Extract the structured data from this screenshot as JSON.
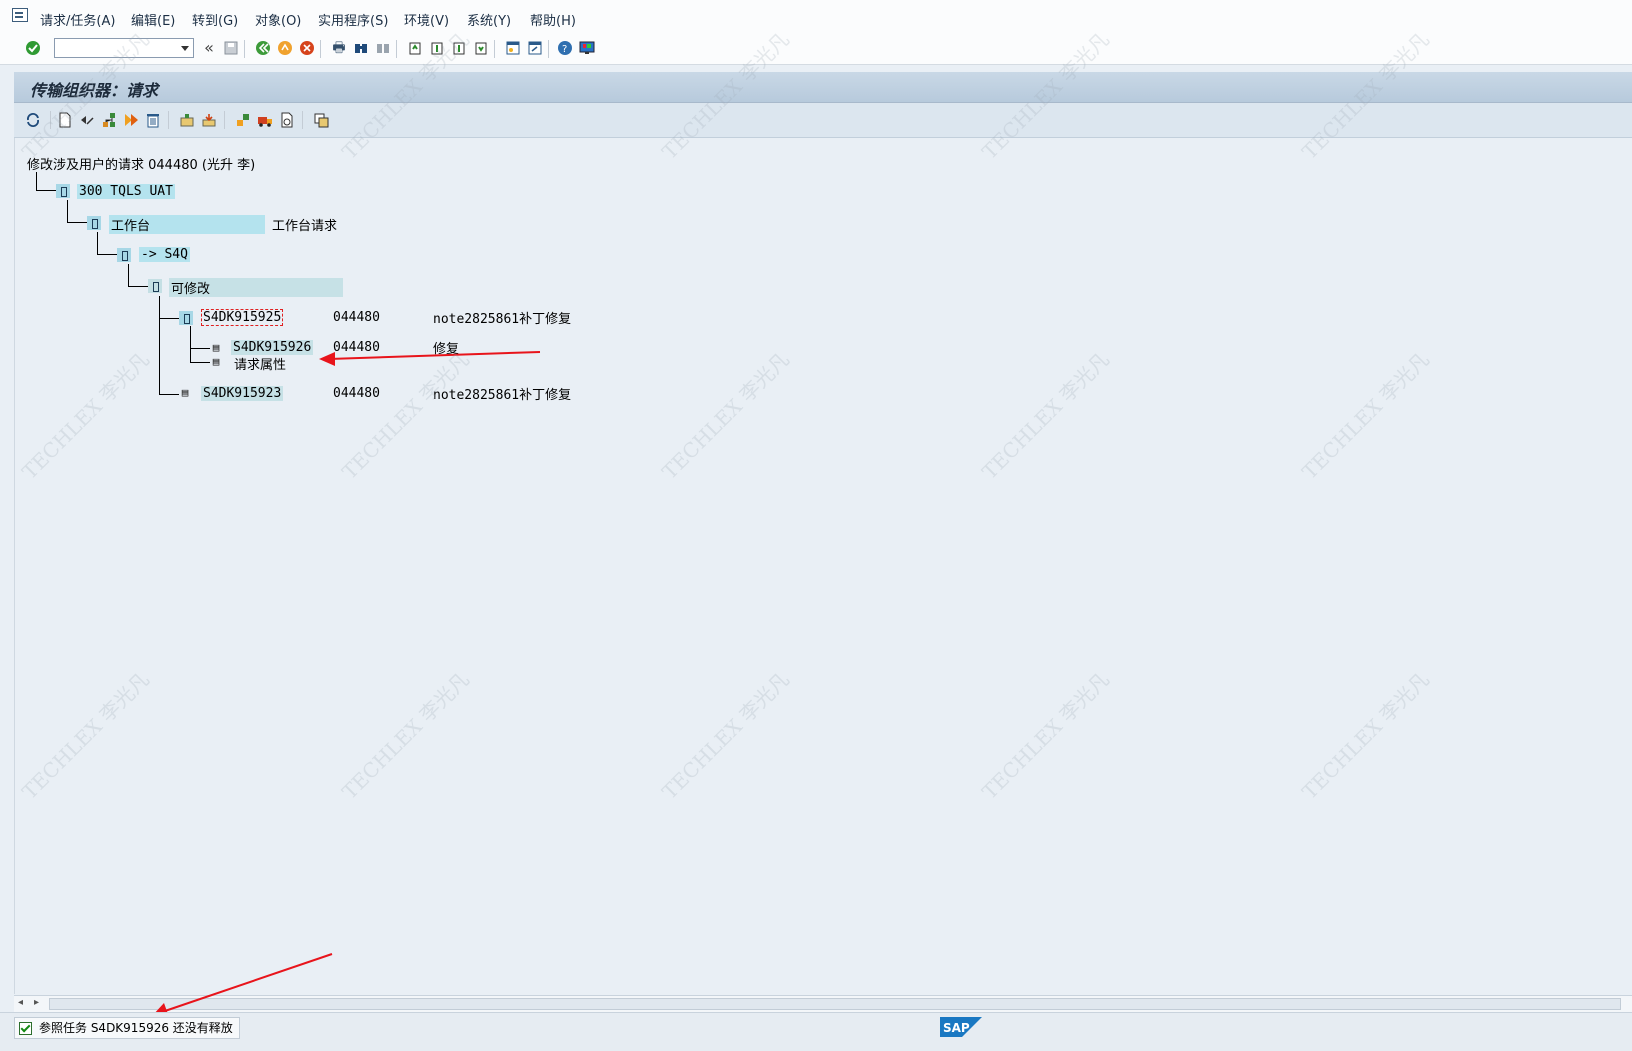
{
  "menu": {
    "items": [
      "请求/任务(A)",
      "编辑(E)",
      "转到(G)",
      "对象(O)",
      "实用程序(S)",
      "环境(V)",
      "系统(Y)",
      "帮助(H)"
    ]
  },
  "command_field": {
    "value": ""
  },
  "title": "传输组织器：请求",
  "tree": {
    "root": "修改涉及用户的请求 044480 (光升 李)",
    "client": "300 TQLS UAT",
    "workbench": "工作台",
    "workbench_desc": "工作台请求",
    "target": "-> S4Q",
    "modifiable": "可修改",
    "requests": [
      {
        "id": "S4DK915925",
        "owner": "044480",
        "desc": "note2825861补丁修复"
      },
      {
        "id": "S4DK915926",
        "owner": "044480",
        "desc": "修复"
      },
      {
        "id": "请求属性",
        "owner": "",
        "desc": ""
      },
      {
        "id": "S4DK915923",
        "owner": "044480",
        "desc": "note2825861补丁修复"
      }
    ]
  },
  "status": {
    "message": "参照任务 S4DK915926 还没有释放"
  },
  "sap_logo": "SAP",
  "watermark": "TECHLEX 李光凡",
  "colors": {
    "accent_arrow": "#e8141b",
    "highlight": "#b4e3ee"
  }
}
